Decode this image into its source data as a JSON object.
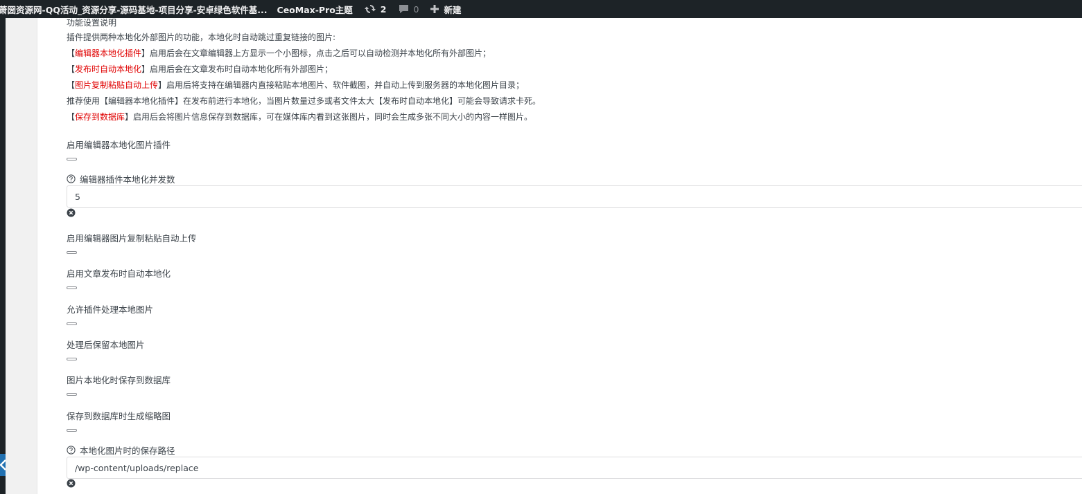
{
  "adminbar": {
    "site_title": "萧圀资源网-QQ活动_资源分享-源码基地-项目分享-安卓绿色软件基...",
    "theme_link": "CeoMax-Pro主题",
    "updates_count": "2",
    "comments_count": "0",
    "new_label": "新建",
    "icons": [
      "updates-icon",
      "comment-icon",
      "plus-icon"
    ]
  },
  "description": {
    "title": "功能设置说明",
    "intro": "插件提供两种本地化外部图片的功能，本地化时自动跳过重复链接的图片:",
    "items": [
      {
        "bracket_open": "【",
        "name": "编辑器本地化插件",
        "bracket_close": "】",
        "text": "启用后会在文章编辑器上方显示一个小图标，点击之后可以自动检测并本地化所有外部图片；"
      },
      {
        "bracket_open": "【",
        "name": "发布时自动本地化",
        "bracket_close": "】",
        "text": "启用后会在文章发布时自动本地化所有外部图片；"
      },
      {
        "bracket_open": "【",
        "name": "图片复制粘贴自动上传",
        "bracket_close": "】",
        "text": "启用后将支持在编辑器内直接粘贴本地图片、软件截图，并自动上传到服务器的本地化图片目录；"
      }
    ],
    "recommend": "推荐使用【编辑器本地化插件】在发布前进行本地化，当图片数量过多或者文件太大【发布时自动本地化】可能会导致请求卡死。",
    "db_item": {
      "bracket_open": "【",
      "name": "保存到数据库",
      "bracket_close": "】",
      "text": "启用后会将图片信息保存到数据库，可在媒体库内看到这张图片，同时会生成多张不同大小的内容一样图片。"
    }
  },
  "settings": {
    "enable_editor_plugin": "启用编辑器本地化图片插件",
    "concurrency_label": "编辑器插件本地化并发数",
    "concurrency_value": "5",
    "enable_paste_upload": "启用编辑器图片复制粘贴自动上传",
    "enable_publish_localize": "启用文章发布时自动本地化",
    "allow_local_images": "允许插件处理本地图片",
    "keep_local_images": "处理后保留本地图片",
    "save_to_db": "图片本地化时保存到数据库",
    "generate_thumbnails": "保存到数据库时生成缩略图",
    "save_path_label": "本地化图片时的保存路径",
    "save_path_value": "/wp-content/uploads/replace"
  }
}
